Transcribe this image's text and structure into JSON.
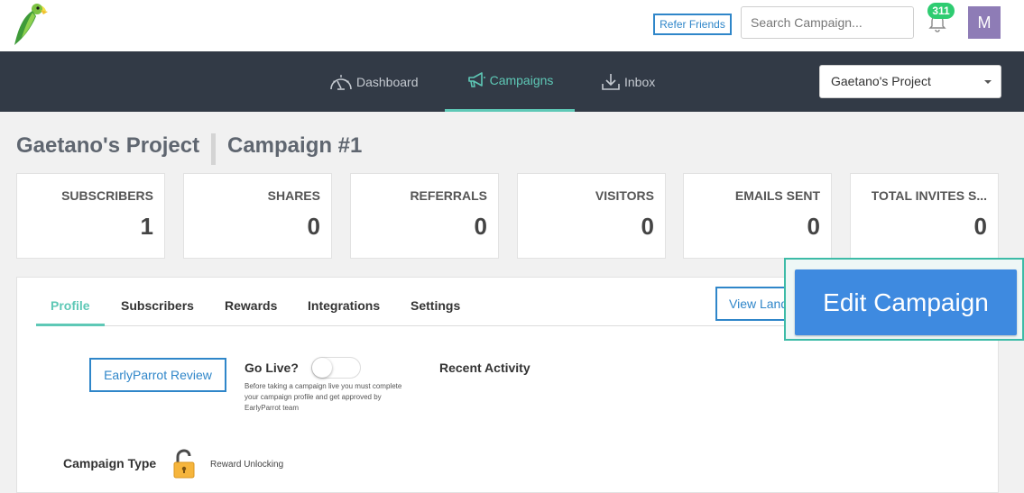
{
  "topbar": {
    "refer_label": "Refer Friends",
    "search_placeholder": "Search Campaign...",
    "notification_count": "311",
    "avatar_initial": "M"
  },
  "nav": {
    "items": [
      {
        "label": "Dashboard",
        "icon": "speedometer-icon"
      },
      {
        "label": "Campaigns",
        "icon": "megaphone-icon",
        "active": true
      },
      {
        "label": "Inbox",
        "icon": "download-inbox-icon"
      }
    ],
    "project_select": "Gaetano's Project"
  },
  "breadcrumb": {
    "project": "Gaetano's Project",
    "campaign": "Campaign #1"
  },
  "stats": [
    {
      "label": "SUBSCRIBERS",
      "value": "1"
    },
    {
      "label": "SHARES",
      "value": "0"
    },
    {
      "label": "REFERRALS",
      "value": "0"
    },
    {
      "label": "VISITORS",
      "value": "0"
    },
    {
      "label": "EMAILS SENT",
      "value": "0"
    },
    {
      "label": "TOTAL INVITES S...",
      "value": "0"
    }
  ],
  "tabs": [
    {
      "label": "Profile",
      "active": true
    },
    {
      "label": "Subscribers"
    },
    {
      "label": "Rewards"
    },
    {
      "label": "Integrations"
    },
    {
      "label": "Settings"
    }
  ],
  "actions": {
    "view_landing": "View Land",
    "edit_campaign": "Edit Campaign"
  },
  "profile": {
    "review_button": "EarlyParrot Review",
    "go_live_label": "Go Live?",
    "go_live_enabled": false,
    "go_live_note": "Before taking a campaign live you must complete your campaign profile and get approved by EarlyParrot team",
    "recent_activity": "Recent Activity",
    "campaign_type_label": "Campaign Type",
    "campaign_type_value": "Reward Unlocking"
  },
  "colors": {
    "accent": "#5ec8b6",
    "link": "#2f86c9",
    "nav_bg": "#323a46",
    "edit_button": "#3e8ae0",
    "badge": "#2ecc71"
  }
}
